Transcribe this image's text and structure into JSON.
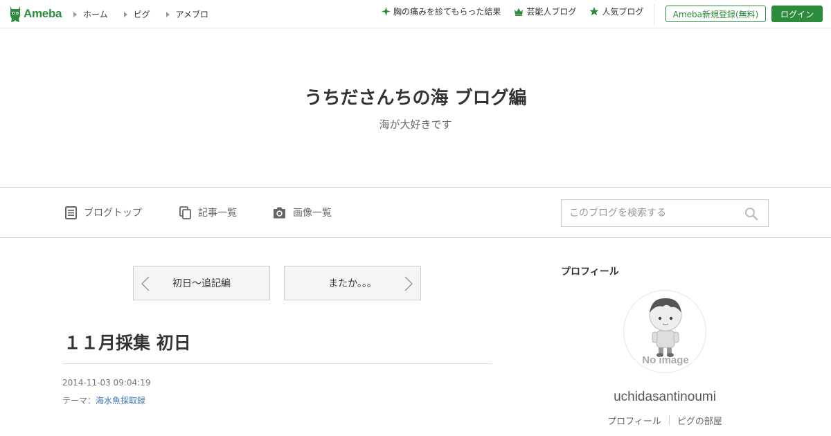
{
  "header": {
    "logo_text": "Ameba",
    "nav": [
      {
        "label": "ホーム"
      },
      {
        "label": "ピグ"
      },
      {
        "label": "アメブロ"
      }
    ],
    "right_links": [
      {
        "label": "胸の痛みを診てもらった結果",
        "icon": "sparkle-icon"
      },
      {
        "label": "芸能人ブログ",
        "icon": "crown-icon"
      },
      {
        "label": "人気ブログ",
        "icon": "star-icon"
      }
    ],
    "register_label": "Ameba新規登録(無料)",
    "login_label": "ログイン",
    "accent_color": "#2d8c3c"
  },
  "blog": {
    "title": "うちださんちの海 ブログ編",
    "subtitle": "海が大好きです"
  },
  "blog_nav": {
    "items": [
      {
        "label": "ブログトップ",
        "icon": "document-icon"
      },
      {
        "label": "記事一覧",
        "icon": "copy-icon"
      },
      {
        "label": "画像一覧",
        "icon": "camera-icon"
      }
    ],
    "search": {
      "placeholder": "このブログを検索する",
      "value": ""
    }
  },
  "pager": {
    "prev_label": "初日～追記編",
    "next_label": "またか。。。"
  },
  "entry": {
    "title": "１１月採集 初日",
    "date": "2014-11-03 09:04:19",
    "theme_prefix": "テーマ：",
    "theme": "海水魚採取録"
  },
  "sidebar": {
    "heading": "プロフィール",
    "avatar_text": "No image",
    "username": "uchidasantinoumi",
    "links": [
      {
        "label": "プロフィール"
      },
      {
        "label": "ピグの部屋"
      }
    ]
  }
}
